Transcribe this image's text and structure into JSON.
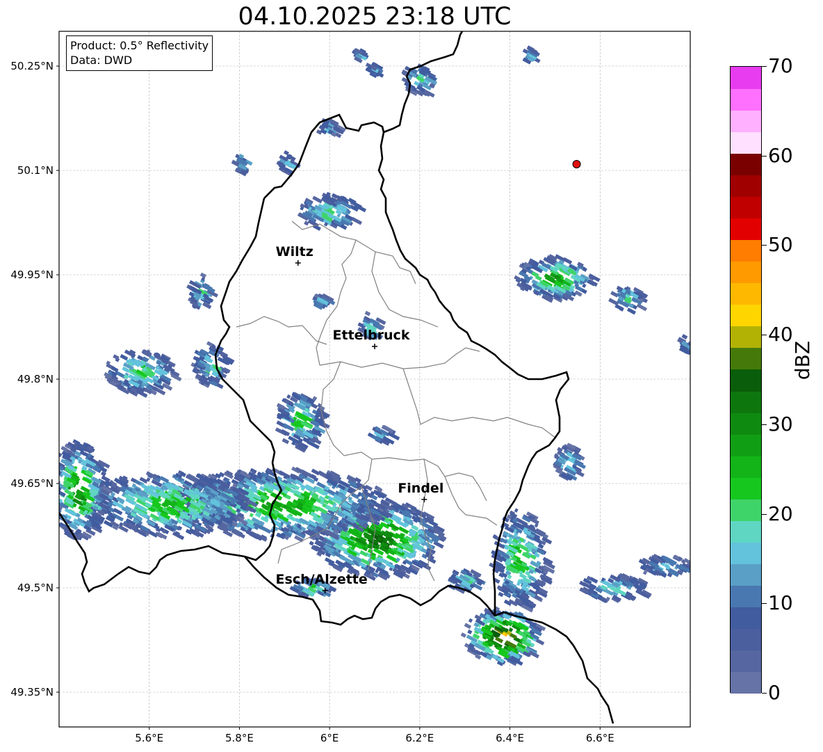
{
  "title": "04.10.2025 23:18 UTC",
  "info": {
    "product": "Product: 0.5° Reflectivity",
    "data": "Data: DWD"
  },
  "map": {
    "lon_range": [
      5.4,
      6.8
    ],
    "lat_range": [
      49.3,
      50.3
    ],
    "x_ticks": [
      {
        "value": 5.6,
        "label": "5.6°E"
      },
      {
        "value": 5.8,
        "label": "5.8°E"
      },
      {
        "value": 6.0,
        "label": "6°E"
      },
      {
        "value": 6.2,
        "label": "6.2°E"
      },
      {
        "value": 6.4,
        "label": "6.4°E"
      },
      {
        "value": 6.6,
        "label": "6.6°E"
      }
    ],
    "y_ticks": [
      {
        "value": 50.25,
        "label": "50.25°N"
      },
      {
        "value": 50.1,
        "label": "50.1°N"
      },
      {
        "value": 49.95,
        "label": "49.95°N"
      },
      {
        "value": 49.8,
        "label": "49.8°N"
      },
      {
        "value": 49.65,
        "label": "49.65°N"
      },
      {
        "value": 49.5,
        "label": "49.5°N"
      },
      {
        "value": 49.35,
        "label": "49.35°N"
      }
    ],
    "cities": [
      {
        "name": "Wiltz",
        "lon": 5.93,
        "lat": 49.967
      },
      {
        "name": "Ettelbruck",
        "lon": 6.1,
        "lat": 49.847
      },
      {
        "name": "Findel",
        "lon": 6.21,
        "lat": 49.627
      },
      {
        "name": "Esch/Alzette",
        "lon": 5.99,
        "lat": 49.496
      }
    ],
    "radar_site": {
      "lon": 6.548,
      "lat": 50.109,
      "color": "#e01010"
    }
  },
  "colorbar": {
    "title": "dBZ",
    "min": 0,
    "max": 70,
    "ticks": [
      0,
      10,
      20,
      30,
      40,
      50,
      60,
      70
    ],
    "colors": [
      "#6573a6",
      "#5666a0",
      "#4b5e9e",
      "#415c9f",
      "#4978b0",
      "#5a9fc6",
      "#63c3dc",
      "#5fd6c2",
      "#3fd46a",
      "#16c81e",
      "#12b417",
      "#109f14",
      "#0f8a10",
      "#0d770e",
      "#0a5d0a",
      "#457a0a",
      "#b2b205",
      "#ffd500",
      "#ffb800",
      "#ff9a00",
      "#ff7d00",
      "#e30000",
      "#c00000",
      "#a00000",
      "#7a0000",
      "#ffe0ff",
      "#ffb0ff",
      "#ff70ff",
      "#e83cf0"
    ]
  }
}
